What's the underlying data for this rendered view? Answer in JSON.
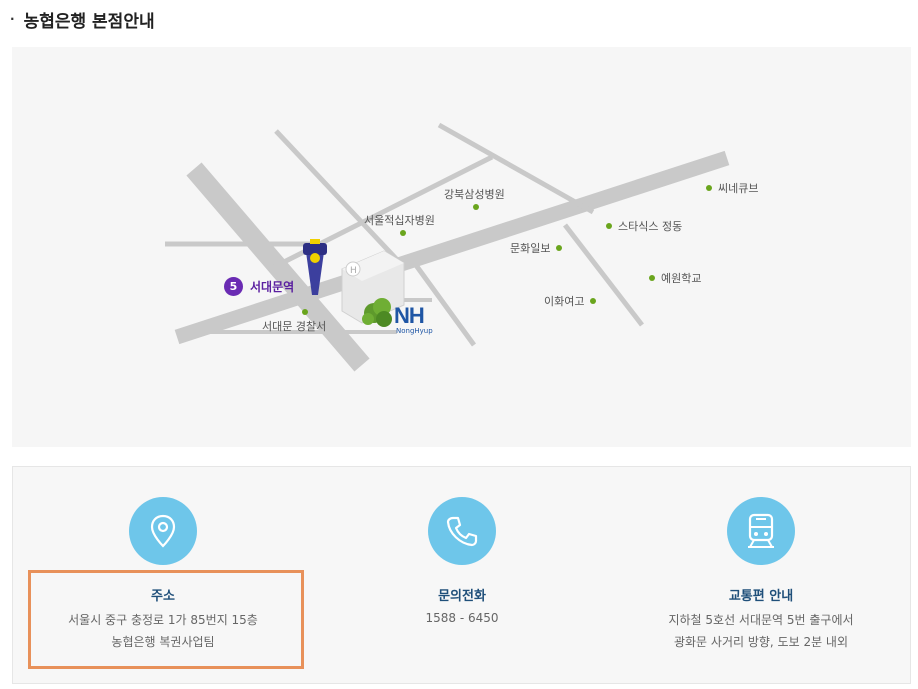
{
  "page": {
    "title": "농협은행 본점안내"
  },
  "map": {
    "station": {
      "line_number": "5",
      "name": "서대문역"
    },
    "landmarks": [
      {
        "id": "kangbuk",
        "label": "강북삼성병원"
      },
      {
        "id": "redcross",
        "label": "서울적십자병원"
      },
      {
        "id": "munhwa",
        "label": "문화일보"
      },
      {
        "id": "police",
        "label": "서대문 경찰서"
      },
      {
        "id": "ewha",
        "label": "이화여고"
      },
      {
        "id": "statics",
        "label": "스타식스 정동"
      },
      {
        "id": "yewon",
        "label": "예원학교"
      },
      {
        "id": "cinecube",
        "label": "씨네큐브"
      }
    ],
    "building": {
      "logo_text": "NH",
      "logo_subtext": "NongHyup"
    },
    "colors": {
      "road": "#c9c9c9",
      "dot": "#6aa51d",
      "station": "#6a2bb3",
      "logo": "#1f56a5"
    }
  },
  "info": {
    "address": {
      "icon": "location-pin-icon",
      "heading": "주소",
      "lines": [
        "서울시 중구 충정로 1가 85번지 15층",
        "농협은행 복권사업팀"
      ]
    },
    "phone": {
      "icon": "phone-icon",
      "heading": "문의전화",
      "lines": [
        "1588 - 6450"
      ]
    },
    "transit": {
      "icon": "train-icon",
      "heading": "교통편 안내",
      "lines": [
        "지하철 5호선 서대문역 5번 출구에서",
        "광화문 사거리 방향, 도보 2분 내외"
      ]
    },
    "colors": {
      "icon_bg": "#6ec6ea",
      "heading": "#1f4f7a",
      "highlight": "#e8915a"
    }
  }
}
